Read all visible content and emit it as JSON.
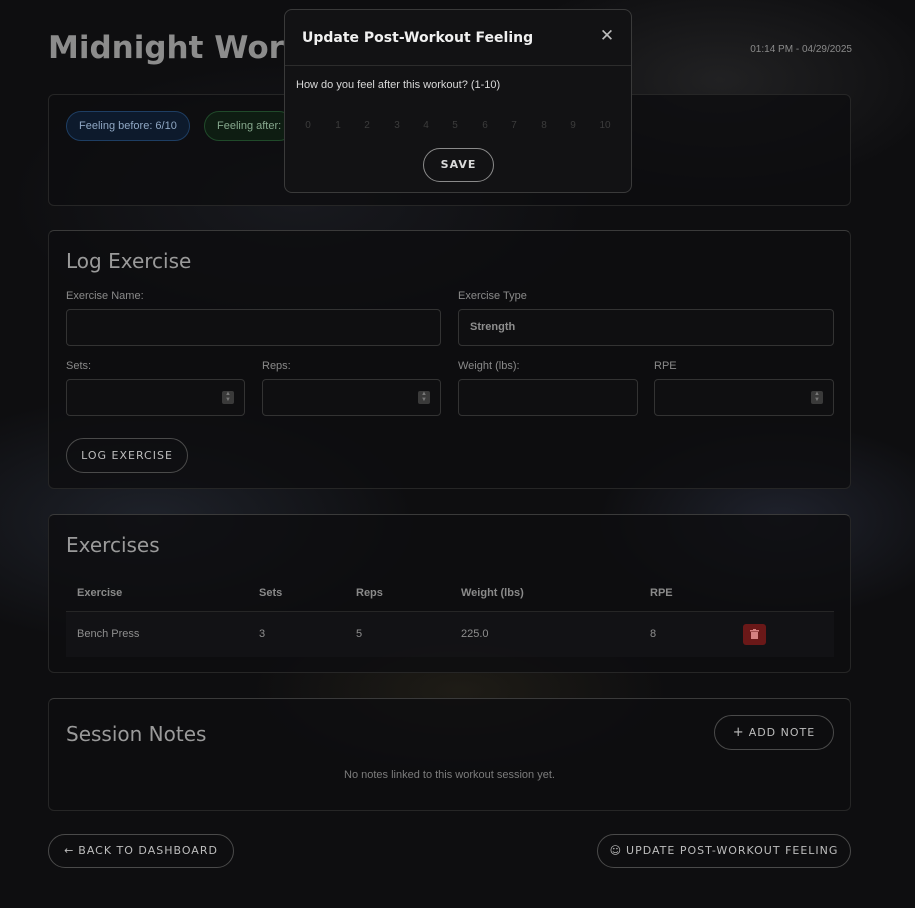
{
  "header": {
    "title": "Midnight Workout",
    "datetime": "01:14 PM - 04/29/2025"
  },
  "feelings": {
    "before": "Feeling before: 6/10",
    "after": "Feeling after:"
  },
  "log_exercise": {
    "heading": "Log Exercise",
    "exercise_name_label": "Exercise Name:",
    "exercise_name_value": "",
    "exercise_type_label": "Exercise Type",
    "exercise_type_value": "Strength",
    "sets_label": "Sets:",
    "reps_label": "Reps:",
    "weight_label": "Weight (lbs):",
    "rpe_label": "RPE",
    "submit_label": "LOG EXERCISE"
  },
  "exercises": {
    "heading": "Exercises",
    "columns": [
      "Exercise",
      "Sets",
      "Reps",
      "Weight (lbs)",
      "RPE"
    ],
    "rows": [
      {
        "exercise": "Bench Press",
        "sets": "3",
        "reps": "5",
        "weight": "225.0",
        "rpe": "8"
      }
    ]
  },
  "session_notes": {
    "heading": "Session Notes",
    "add_note_label": "ADD NOTE",
    "empty_text": "No notes linked to this workout session yet."
  },
  "footer": {
    "back_label": "BACK TO DASHBOARD",
    "update_label": "UPDATE POST-WORKOUT FEELING"
  },
  "modal": {
    "title": "Update Post-Workout Feeling",
    "question": "How do you feel after this workout? (1-10)",
    "scale": [
      "0",
      "1",
      "2",
      "3",
      "4",
      "5",
      "6",
      "7",
      "8",
      "9",
      "10"
    ],
    "save_label": "SAVE"
  },
  "colors": {
    "background": "#0e0e10",
    "delete_button": "#6a1818",
    "feeling_before_pill": "#1e3e63",
    "feeling_after_pill": "#204a2a"
  }
}
